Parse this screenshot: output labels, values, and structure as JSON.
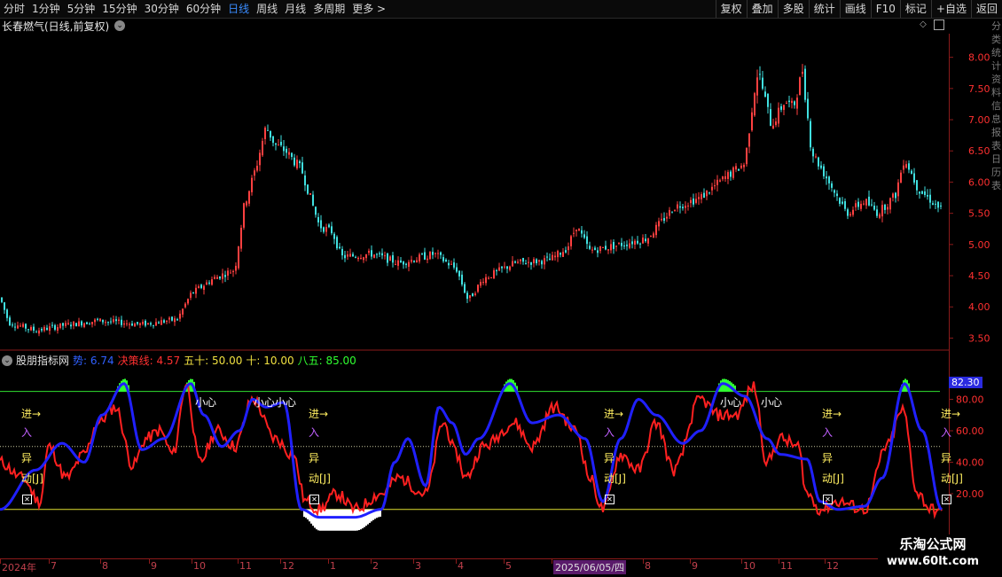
{
  "toolbar": {
    "periods": [
      "分时",
      "1分钟",
      "5分钟",
      "15分钟",
      "30分钟",
      "60分钟",
      "日线",
      "周线",
      "月线",
      "多周期",
      "更多 >"
    ],
    "active_period": "日线",
    "right_buttons": [
      "复权",
      "叠加",
      "多股",
      "统计",
      "画线",
      "F10",
      "标记",
      "+自选",
      "返回"
    ]
  },
  "stock": {
    "title": "长春燃气(日线,前复权)"
  },
  "price_axis": {
    "ticks": [
      "8.00",
      "7.50",
      "7.00",
      "6.50",
      "6.00",
      "5.50",
      "5.00",
      "4.50",
      "4.00",
      "3.50"
    ],
    "range": [
      3.35,
      8.35
    ],
    "color": "#ff3030"
  },
  "indicator": {
    "name": "股朋指标网",
    "label_shi": "势: 6.74",
    "label_juece": "决策线: 4.57",
    "label_wushi": "五十: 50.00",
    "label_shi2": "十: 10.00",
    "label_bawu": "八五: 85.00",
    "current_value": "82.30",
    "axis_ticks": [
      "80.00",
      "60.00",
      "40.00",
      "20.00"
    ],
    "range": [
      -20,
      100
    ],
    "signal_labels": {
      "jin": "进→",
      "ru": "入",
      "yi": "异",
      "dong": "动[J]",
      "xiaoxin": "小心",
      "xiaoxin2": "小心小心"
    },
    "colors": {
      "shi": "#2020ff",
      "juece": "#ff2020",
      "line85": "#30e030",
      "line10": "#e0e030",
      "line50": "#c8c8a0"
    }
  },
  "date_axis": {
    "labels": [
      "2024年",
      "7",
      "8",
      "9",
      "10",
      "11",
      "12",
      "1",
      "2",
      "3",
      "4",
      "5",
      "2025/06/05/四",
      "8",
      "9",
      "10",
      "11",
      "12"
    ]
  },
  "sidebar": {
    "text": "分类统计资料信息报表日历表"
  },
  "watermark": {
    "title": "乐淘公式网",
    "url": "www.60lt.com"
  }
}
